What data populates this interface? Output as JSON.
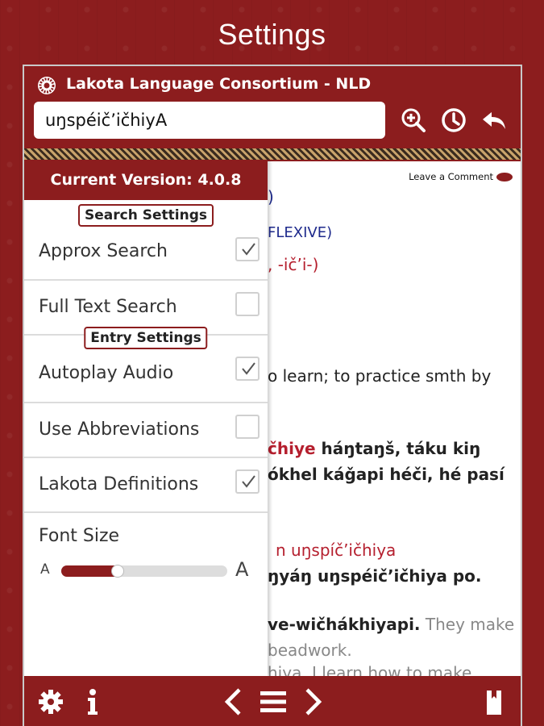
{
  "page_title": "Settings",
  "app": {
    "title": "Lakota Language Consortium - NLD",
    "search_value": "uŋspéič’ičhiyA",
    "icons": [
      "zoom-in-icon",
      "history-icon",
      "back-icon"
    ]
  },
  "content": {
    "leave_comment": "Leave a Comment",
    "lines": [
      {
        "text": ")",
        "cls": "blue"
      },
      {
        "text": "FLEXIVE)",
        "cls": "blue"
      },
      {
        "text": ", -ič’i-)",
        "cls": ""
      },
      {
        "text": "o learn; to practice smth by",
        "cls": ""
      },
      {
        "text": "čhiye háŋtaŋš, táku kiŋ",
        "cls": "b"
      },
      {
        "text": "ókhel káǧapi héči, hé pasí",
        "cls": "b"
      },
      {
        "text": "uŋspíč’ičhiya",
        "cls": "red"
      },
      {
        "text": "ŋyáŋ uŋspéič’ičhiya po.",
        "cls": "b"
      },
      {
        "text": "ve-wičhákhiyapi.",
        "cls": "b"
      },
      {
        "text": "They make",
        "cls": "gray"
      },
      {
        "text": "beadwork.",
        "cls": "gray"
      },
      {
        "text": "hiya. I learn how to make",
        "cls": "gray"
      }
    ]
  },
  "drawer": {
    "version": "Current Version: 4.0.8",
    "search_settings": "Search Settings",
    "entry_settings": "Entry Settings",
    "options": [
      {
        "label": "Approx Search",
        "checked": true
      },
      {
        "label": "Full Text Search",
        "checked": false
      },
      {
        "label": "Autoplay Audio",
        "checked": true
      },
      {
        "label": "Use Abbreviations",
        "checked": false
      },
      {
        "label": "Lakota Definitions",
        "checked": true
      }
    ],
    "font_size": {
      "label": "Font Size",
      "small_a": "A",
      "large_a": "A",
      "value": 0.34
    }
  },
  "bottom_bar": {
    "icons": [
      "gear-icon",
      "info-icon",
      "prev-icon",
      "menu-icon",
      "next-icon",
      "bookmark-icon"
    ]
  },
  "colors": {
    "brand": "#8c1d1e",
    "link_blue": "#1e2a8c",
    "red_text": "#b51f2e"
  }
}
